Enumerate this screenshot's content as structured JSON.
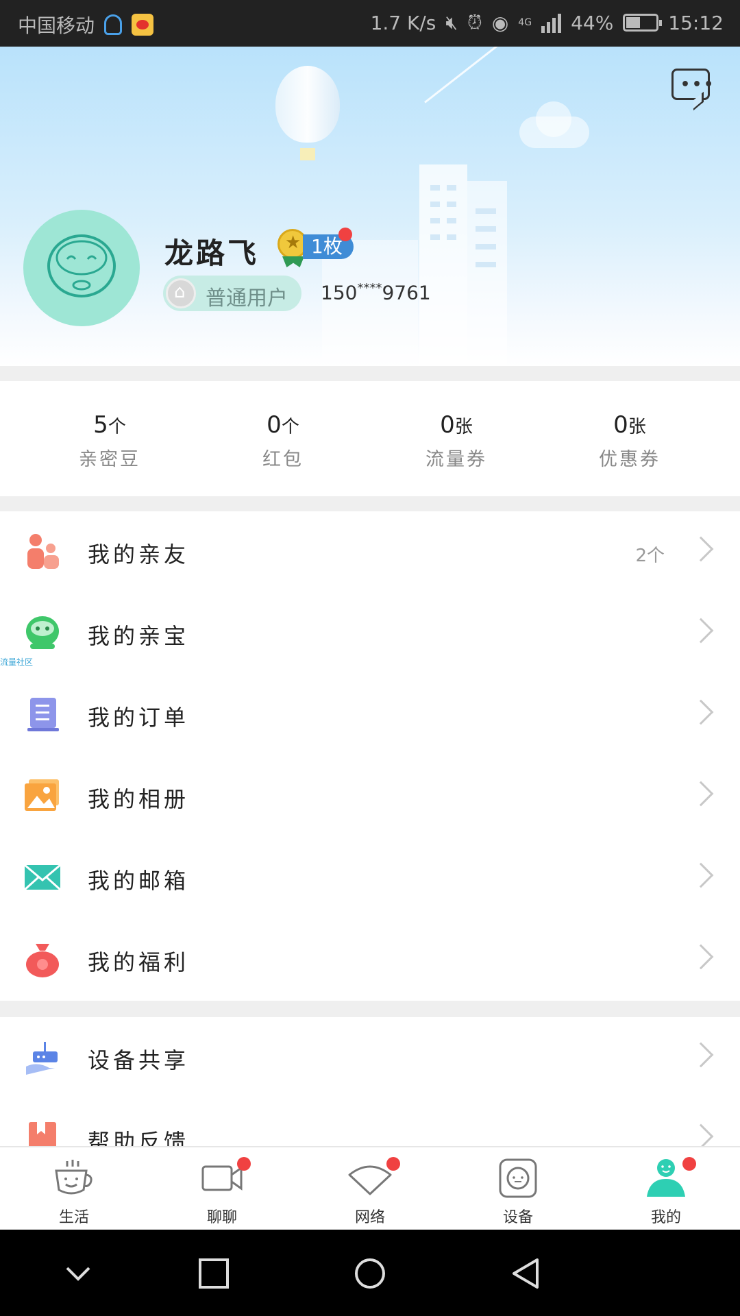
{
  "status_bar": {
    "carrier": "中国移动",
    "speed": "1.7 K/s",
    "network": "4G",
    "battery": "44%",
    "time": "15:12"
  },
  "profile": {
    "name": "龙路飞",
    "medal_count": "1枚",
    "level": "普通用户",
    "phone": "150",
    "phone_mask": "****",
    "phone_tail": "9761"
  },
  "stats": [
    {
      "value": "5",
      "unit": "个",
      "label": "亲密豆"
    },
    {
      "value": "0",
      "unit": "个",
      "label": "红包"
    },
    {
      "value": "0",
      "unit": "张",
      "label": "流量券"
    },
    {
      "value": "0",
      "unit": "张",
      "label": "优惠券"
    }
  ],
  "menu": [
    {
      "label": "我的亲友",
      "value": "2个",
      "icon": "friends-icon"
    },
    {
      "label": "我的亲宝",
      "value": "",
      "icon": "robot-icon",
      "tag": "流量社区"
    },
    {
      "label": "我的订单",
      "value": "",
      "icon": "order-icon"
    },
    {
      "label": "我的相册",
      "value": "",
      "icon": "album-icon"
    },
    {
      "label": "我的邮箱",
      "value": "",
      "icon": "mail-icon"
    },
    {
      "label": "我的福利",
      "value": "",
      "icon": "gift-bag-icon"
    }
  ],
  "menu2": [
    {
      "label": "设备共享",
      "icon": "device-share-icon"
    },
    {
      "label": "帮助反馈",
      "icon": "help-feedback-icon"
    }
  ],
  "bottom_nav": [
    {
      "label": "生活",
      "icon": "cup-icon",
      "badge": false
    },
    {
      "label": "聊聊",
      "icon": "video-icon",
      "badge": true
    },
    {
      "label": "网络",
      "icon": "wifi-icon",
      "badge": true
    },
    {
      "label": "设备",
      "icon": "device-icon",
      "badge": false
    },
    {
      "label": "我的",
      "icon": "person-icon",
      "badge": true,
      "active": true
    }
  ],
  "colors": {
    "accent": "#2ecfb3",
    "badge": "#f04141",
    "medal_blue": "#3f8cd6"
  }
}
